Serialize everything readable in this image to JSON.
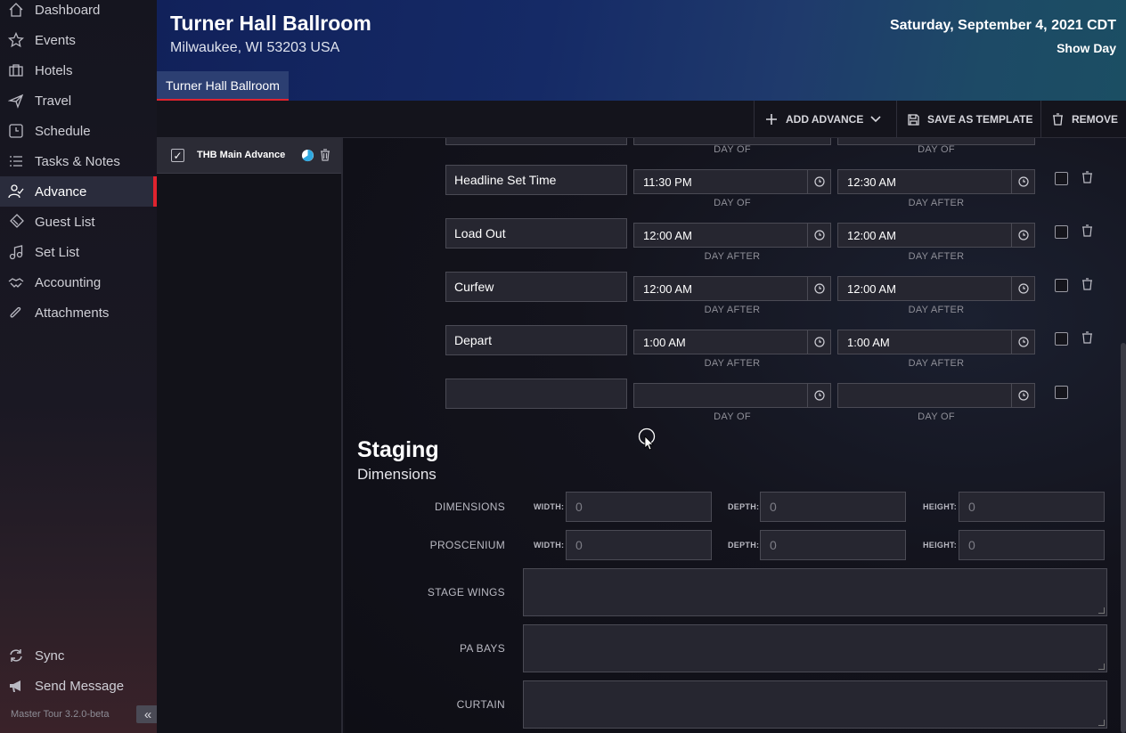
{
  "sidebar": {
    "items": [
      {
        "label": "Dashboard",
        "icon": "home-icon"
      },
      {
        "label": "Events",
        "icon": "star-icon"
      },
      {
        "label": "Hotels",
        "icon": "hotel-icon"
      },
      {
        "label": "Travel",
        "icon": "plane-icon"
      },
      {
        "label": "Schedule",
        "icon": "clock-icon"
      },
      {
        "label": "Tasks & Notes",
        "icon": "list-icon"
      },
      {
        "label": "Advance",
        "icon": "person-check-icon",
        "active": true
      },
      {
        "label": "Guest List",
        "icon": "ticket-icon"
      },
      {
        "label": "Set List",
        "icon": "music-note-icon"
      },
      {
        "label": "Accounting",
        "icon": "handshake-icon"
      },
      {
        "label": "Attachments",
        "icon": "paperclip-icon"
      }
    ],
    "bottom_items": [
      {
        "label": "Sync",
        "icon": "sync-icon"
      },
      {
        "label": "Send Message",
        "icon": "megaphone-icon"
      }
    ],
    "version": "Master Tour 3.2.0-beta",
    "collapse_glyph": "«"
  },
  "header": {
    "venue_name": "Turner Hall Ballroom",
    "address": "Milwaukee, WI 53203 USA",
    "date": "Saturday, September 4, 2021 CDT",
    "day_type": "Show Day",
    "tab_label": "Turner Hall Ballroom"
  },
  "toolbar": {
    "add_advance": "ADD ADVANCE",
    "save_template": "SAVE AS TEMPLATE",
    "remove": "REMOVE"
  },
  "advance_list": {
    "items": [
      {
        "name": "THB Main Advance",
        "checked": true
      }
    ]
  },
  "schedule": {
    "top_labels": {
      "start_sub": "DAY OF",
      "end_sub": "DAY OF"
    },
    "rows": [
      {
        "name": "Headline Set Time",
        "start": "11:30 PM",
        "start_sub": "DAY OF",
        "end": "12:30 AM",
        "end_sub": "DAY AFTER"
      },
      {
        "name": "Load Out",
        "start": "12:00 AM",
        "start_sub": "DAY AFTER",
        "end": "12:00 AM",
        "end_sub": "DAY AFTER"
      },
      {
        "name": "Curfew",
        "start": "12:00 AM",
        "start_sub": "DAY AFTER",
        "end": "12:00 AM",
        "end_sub": "DAY AFTER"
      },
      {
        "name": "Depart",
        "start": "1:00 AM",
        "start_sub": "DAY AFTER",
        "end": "1:00 AM",
        "end_sub": "DAY AFTER"
      },
      {
        "name": "",
        "start": "",
        "start_sub": "DAY OF",
        "end": "",
        "end_sub": "DAY OF"
      }
    ]
  },
  "staging": {
    "title": "Staging",
    "subtitle": "Dimensions",
    "dimensions_label": "DIMENSIONS",
    "proscenium_label": "PROSCENIUM",
    "width_label": "WIDTH:",
    "depth_label": "DEPTH:",
    "height_label": "HEIGHT:",
    "dimensions": {
      "width": "0",
      "depth": "0",
      "height": "0"
    },
    "proscenium": {
      "width": "0",
      "depth": "0",
      "height": "0"
    },
    "stage_wings_label": "STAGE WINGS",
    "pa_bays_label": "PA BAYS",
    "curtain_label": "CURTAIN"
  },
  "colors": {
    "accent": "#e0232e",
    "header_blue": "#152a66"
  }
}
